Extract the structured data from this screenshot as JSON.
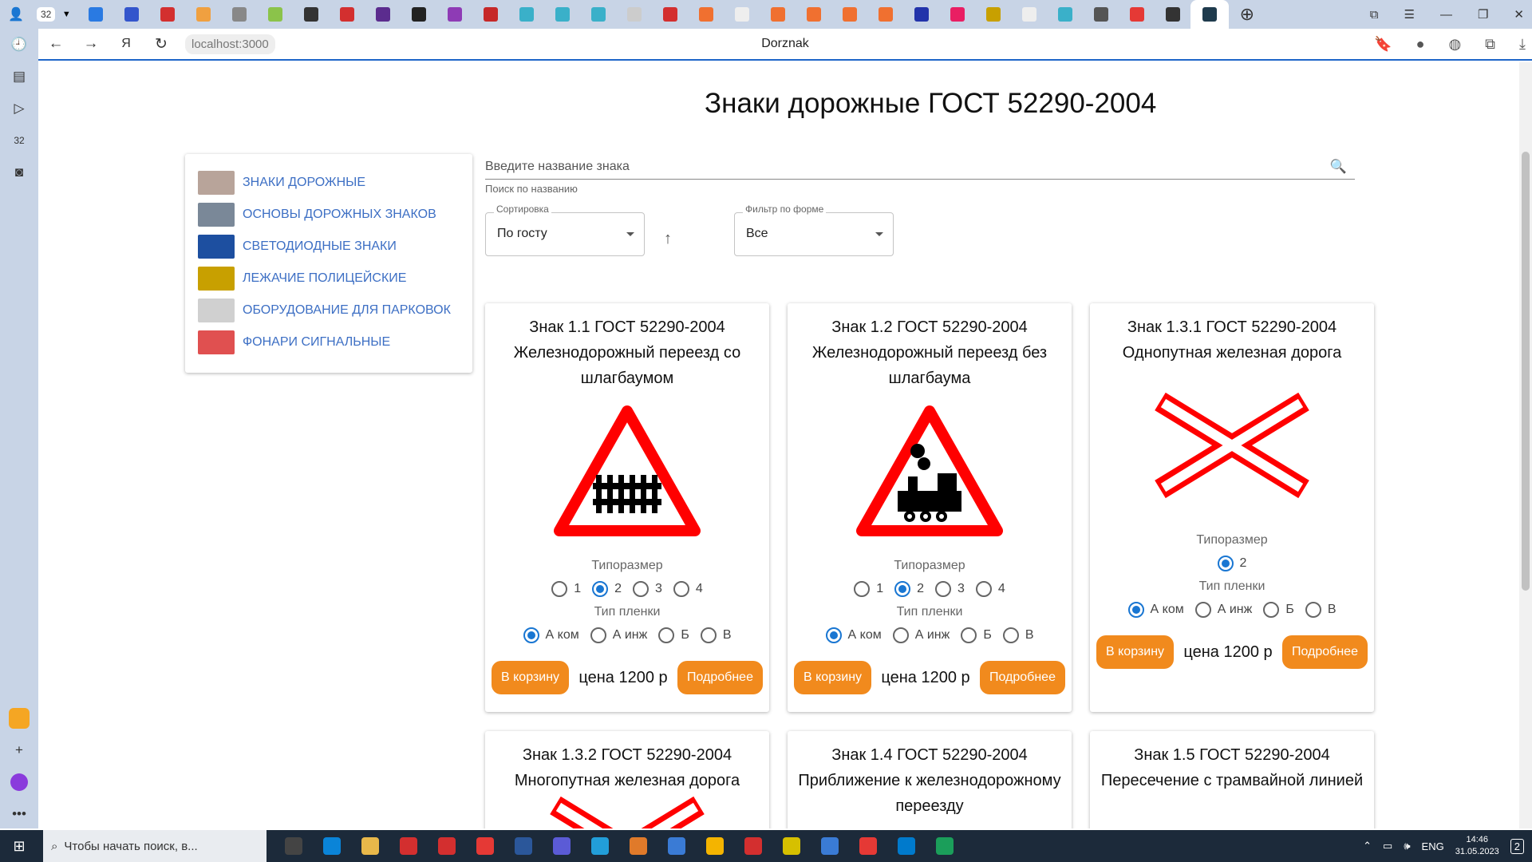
{
  "browser": {
    "tab_count": "32",
    "page_title": "Dorznak",
    "url": "localhost:3000",
    "tab_colors": [
      "#2a7ae2",
      "#3355cc",
      "#d32f2f",
      "#f0a040",
      "#888888",
      "#8bc34a",
      "#333333",
      "#d32f2f",
      "#5b2c8e",
      "#222222",
      "#8e3bb5",
      "#c62828",
      "#3ab0c9",
      "#3ab0c9",
      "#3ab0c9",
      "#cccccc",
      "#d32f2f",
      "#f07030",
      "#eeeeee",
      "#f07030",
      "#f07030",
      "#f07030",
      "#f07030",
      "#2233aa",
      "#e91e63",
      "#c8a000",
      "#eeeeee",
      "#3ab0c9",
      "#555555",
      "#e53935",
      "#333333"
    ]
  },
  "page": {
    "title": "Знаки дорожные ГОСТ 52290-2004"
  },
  "menu": [
    {
      "label": "ЗНАКИ ДОРОЖНЫЕ",
      "color": "#b8a49a"
    },
    {
      "label": "ОСНОВЫ ДОРОЖНЫХ ЗНАКОВ",
      "color": "#7a8898"
    },
    {
      "label": "СВЕТОДИОДНЫЕ ЗНАКИ",
      "color": "#1d4fa0"
    },
    {
      "label": "ЛЕЖАЧИЕ ПОЛИЦЕЙСКИЕ",
      "color": "#c8a000"
    },
    {
      "label": "ОБОРУДОВАНИЕ ДЛЯ ПАРКОВОК",
      "color": "#d0d0d0"
    },
    {
      "label": "ФОНАРИ СИГНАЛЬНЫЕ",
      "color": "#e05050"
    }
  ],
  "search": {
    "placeholder": "Введите название знака",
    "helper": "Поиск по названию"
  },
  "sort": {
    "label": "Сортировка",
    "value": "По госту"
  },
  "filter": {
    "label": "Фильтр по форме",
    "value": "Все"
  },
  "cards": [
    {
      "title": "Знак 1.1 ГОСТ 52290-2004 Железнодорожный переезд со шлагбаумом",
      "size_label": "Типоразмер",
      "sizes": [
        "1",
        "2",
        "3",
        "4"
      ],
      "size_selected": "2",
      "film_label": "Тип пленки",
      "films": [
        "А ком",
        "А инж",
        "Б",
        "В"
      ],
      "film_selected": "А ком",
      "cart": "В корзину",
      "price": "цена 1200 р",
      "more": "Подробнее"
    },
    {
      "title": "Знак 1.2 ГОСТ 52290-2004 Железнодорожный переезд без шлагбаума",
      "size_label": "Типоразмер",
      "sizes": [
        "1",
        "2",
        "3",
        "4"
      ],
      "size_selected": "2",
      "film_label": "Тип пленки",
      "films": [
        "А ком",
        "А инж",
        "Б",
        "В"
      ],
      "film_selected": "А ком",
      "cart": "В корзину",
      "price": "цена 1200 р",
      "more": "Подробнее"
    },
    {
      "title": "Знак 1.3.1 ГОСТ 52290-2004 Однопутная железная дорога",
      "size_label": "Типоразмер",
      "sizes": [
        "2"
      ],
      "size_selected": "2",
      "film_label": "Тип пленки",
      "films": [
        "А ком",
        "А инж",
        "Б",
        "В"
      ],
      "film_selected": "А ком",
      "cart": "В корзину",
      "price": "цена 1200 р",
      "more": "Подробнее"
    },
    {
      "title": "Знак 1.3.2 ГОСТ 52290-2004 Многопутная железная дорога"
    },
    {
      "title": "Знак 1.4 ГОСТ 52290-2004 Приближение к железнодорожному переезду"
    },
    {
      "title": "Знак 1.5 ГОСТ 52290-2004 Пересечение с трамвайной линией"
    }
  ],
  "taskbar": {
    "search_placeholder": "Чтобы начать поиск, в...",
    "app_colors": [
      "#444",
      "#0a84d8",
      "#e8b84a",
      "#d32f2f",
      "#d32f2f",
      "#e53935",
      "#2b579a",
      "#5b5bd6",
      "#229ed9",
      "#e07a2a",
      "#3a7bd5",
      "#f4b400",
      "#d32f2f",
      "#d6c000",
      "#3a7bd5",
      "#e53935",
      "#007acc",
      "#1b9e5a"
    ],
    "lang": "ENG",
    "time": "14:46",
    "date": "31.05.2023",
    "notifications": "2"
  }
}
